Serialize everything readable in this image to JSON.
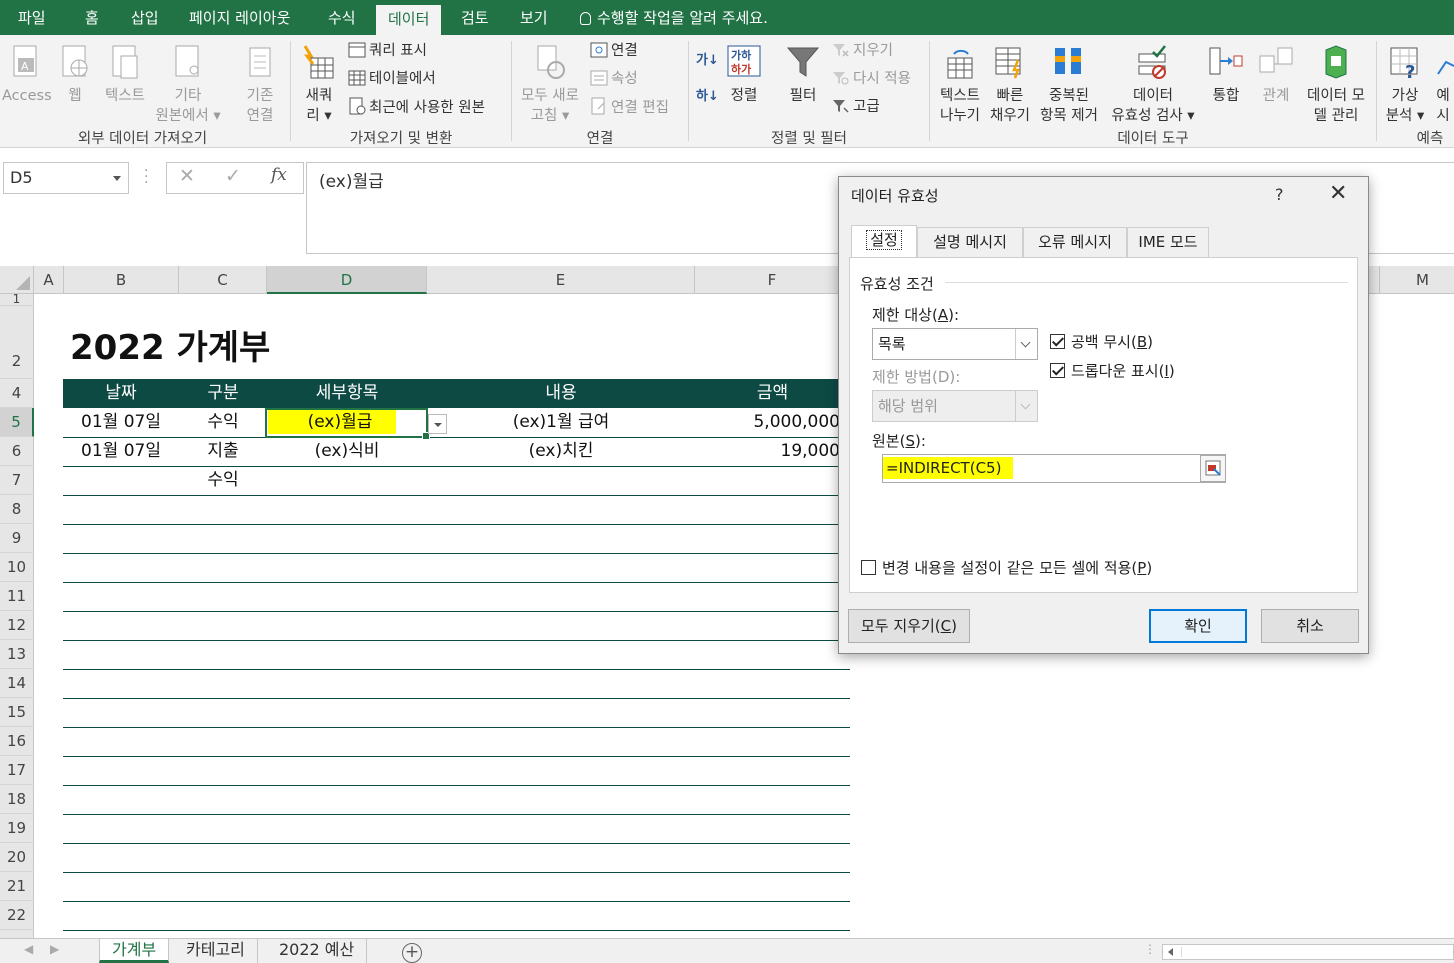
{
  "ribbon_tabs": [
    "파일",
    "홈",
    "삽입",
    "페이지 레이아웃",
    "수식",
    "데이터",
    "검토",
    "보기"
  ],
  "tell_me": "수행할 작업을 알려 주세요.",
  "ribbon": {
    "access": "Access",
    "web": "웹",
    "text": "텍스트",
    "other_1": "기타",
    "other_2": "원본에서 ▾",
    "existing_1": "기존",
    "existing_2": "연결",
    "group_external": "외부 데이터 가져오기",
    "new_query_1": "새쿼",
    "new_query_2": "리 ▾",
    "show_queries": "쿼리 표시",
    "from_table": "테이블에서",
    "recent_sources": "최근에 사용한 원본",
    "group_transform": "가져오기 및 변환",
    "refresh_1": "모두 새로",
    "refresh_2": "고침 ▾",
    "connections": "연결",
    "properties": "속성",
    "edit_links": "연결 편집",
    "group_connections": "연결",
    "sort": "정렬",
    "filter": "필터",
    "clear": "지우기",
    "reapply": "다시 적용",
    "advanced": "고급",
    "group_sort_filter": "정렬 및 필터",
    "text_to_columns_1": "텍스트",
    "text_to_columns_2": "나누기",
    "flash_fill_1": "빠른",
    "flash_fill_2": "채우기",
    "remove_dup_1": "중복된",
    "remove_dup_2": "항목 제거",
    "validation_1": "데이터",
    "validation_2": "유효성 검사 ▾",
    "consolidate": "통합",
    "relationships": "관계",
    "data_model_1": "데이터 모",
    "data_model_2": "델 관리",
    "group_data_tools": "데이터 도구",
    "whatif_1": "가상",
    "whatif_2": "분석 ▾",
    "forecast_1": "예",
    "forecast_2": "시",
    "group_forecast": "예측"
  },
  "formula_bar": {
    "name_box": "D5",
    "cancel": "✕",
    "enter": "✓",
    "fx": "fx",
    "content": "(ex)월급"
  },
  "columns": [
    "A",
    "B",
    "C",
    "D",
    "E",
    "F",
    "M"
  ],
  "rows": [
    "1",
    "2",
    "4",
    "5",
    "6",
    "7",
    "8",
    "9",
    "10",
    "11",
    "12",
    "13",
    "14",
    "15",
    "16",
    "17",
    "18",
    "19",
    "20",
    "21",
    "22"
  ],
  "sheet": {
    "title": "2022 가계부",
    "headers": [
      "날짜",
      "구분",
      "세부항목",
      "내용",
      "금액"
    ],
    "data": [
      [
        "01월 07일",
        "수익",
        "(ex)월급",
        "(ex)1월 급여",
        "5,000,000"
      ],
      [
        "01월 07일",
        "지출",
        "(ex)식비",
        "(ex)치킨",
        "19,000"
      ],
      [
        "",
        "수익",
        "",
        "",
        ""
      ]
    ]
  },
  "sheet_tabs": [
    "가계부",
    "카테고리",
    "2022 예산"
  ],
  "dialog": {
    "title": "데이터 유효성",
    "help": "?",
    "close": "✕",
    "tabs": [
      "설정",
      "설명 메시지",
      "오류 메시지",
      "IME 모드"
    ],
    "group_label": "유효성 조건",
    "allow_label": "제한 대상(",
    "allow_key": "A",
    "allow_value": "목록",
    "ignore_blank": "공백 무시(",
    "ignore_blank_key": "B",
    "in_cell_dropdown": "드롭다운 표시(",
    "in_cell_dropdown_key": "I",
    "data_label": "제한 방법(D):",
    "data_value": "해당 범위",
    "source_label": "원본(",
    "source_key": "S",
    "source_value": "=INDIRECT(C5)",
    "apply_all": "변경 내용을 설정이 같은 모든 셀에 적용(",
    "apply_all_key": "P",
    "clear_all": "모두 지우기(",
    "clear_all_key": "C",
    "ok": "확인",
    "cancel": "취소",
    "paren_close": "):",
    "paren_close_plain": ")"
  },
  "colors": {
    "excel_green": "#217346",
    "table_header": "#0d4a44",
    "highlight": "#ffff00",
    "ok_border": "#0078d7"
  }
}
